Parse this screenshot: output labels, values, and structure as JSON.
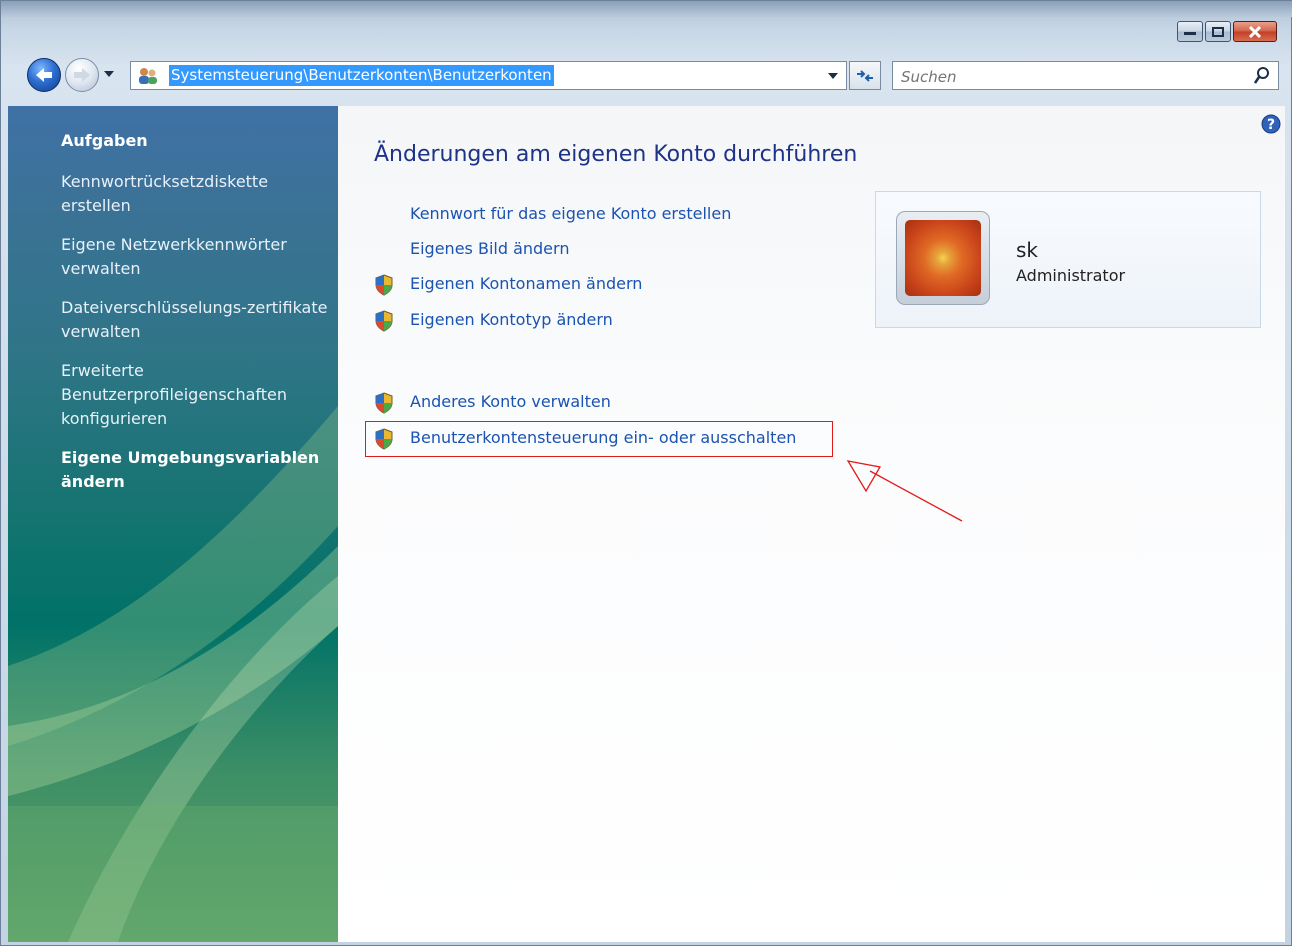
{
  "toolbar": {
    "address": "Systemsteuerung\\Benutzerkonten\\Benutzerkonten",
    "search_placeholder": "Suchen"
  },
  "sidebar": {
    "heading": "Aufgaben",
    "items": [
      "Kennwortrücksetzdiskette erstellen",
      "Eigene Netzwerkkennwörter verwalten",
      "Dateiverschlüsselungs-zertifikate verwalten",
      "Erweiterte Benutzerprofileigenschaften konfigurieren",
      "Eigene Umgebungsvariablen ändern"
    ]
  },
  "main": {
    "title": "Änderungen am eigenen Konto durchführen",
    "tasks": [
      "Kennwort für das eigene Konto erstellen",
      "Eigenes Bild ändern",
      "Eigenen Kontonamen ändern",
      "Eigenen Kontotyp ändern",
      "Anderes Konto verwalten",
      "Benutzerkontensteuerung ein- oder ausschalten"
    ],
    "user": {
      "name": "sk",
      "role": "Administrator"
    }
  },
  "colors": {
    "link": "#1b53b1",
    "title": "#1e3287",
    "highlight": "#e21a1a",
    "address_selection": "#3399ff"
  }
}
